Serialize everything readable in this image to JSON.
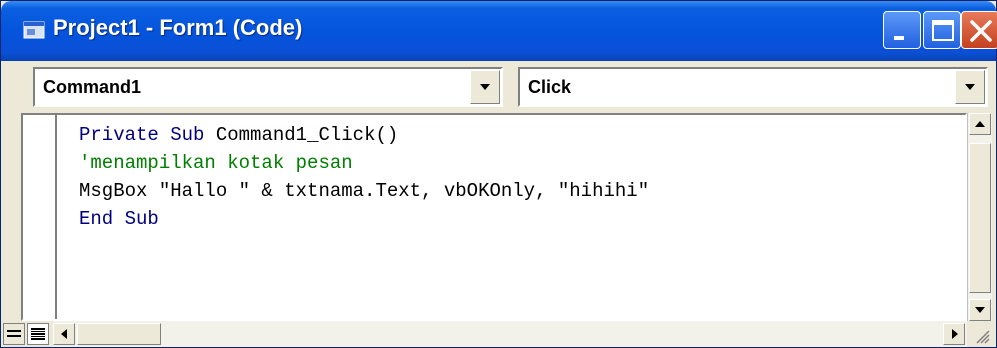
{
  "window": {
    "title": "Project1 - Form1 (Code)",
    "colors": {
      "titlebar": "#0554dd",
      "close": "#c4411f",
      "keyword": "#00007f",
      "comment": "#007f00"
    }
  },
  "toolbar": {
    "object_combo": "Command1",
    "procedure_combo": "Click"
  },
  "code": {
    "line1_kw1": "Private",
    "line1_kw2": "Sub",
    "line1_rest": " Command1_Click()",
    "line2_comment": "'menampilkan kotak pesan",
    "line3_text": "MsgBox \"Hallo \" & txtnama.Text, vbOKOnly, \"hihihi\"",
    "line4_kw1": "End",
    "line4_kw2": "Sub"
  },
  "icons": [
    "form-icon",
    "minimize-icon",
    "maximize-icon",
    "close-icon",
    "dropdown-arrow-icon",
    "scroll-up-icon",
    "scroll-down-icon",
    "scroll-left-icon",
    "scroll-right-icon",
    "procedure-view-icon",
    "full-module-view-icon",
    "resize-grip-icon"
  ]
}
